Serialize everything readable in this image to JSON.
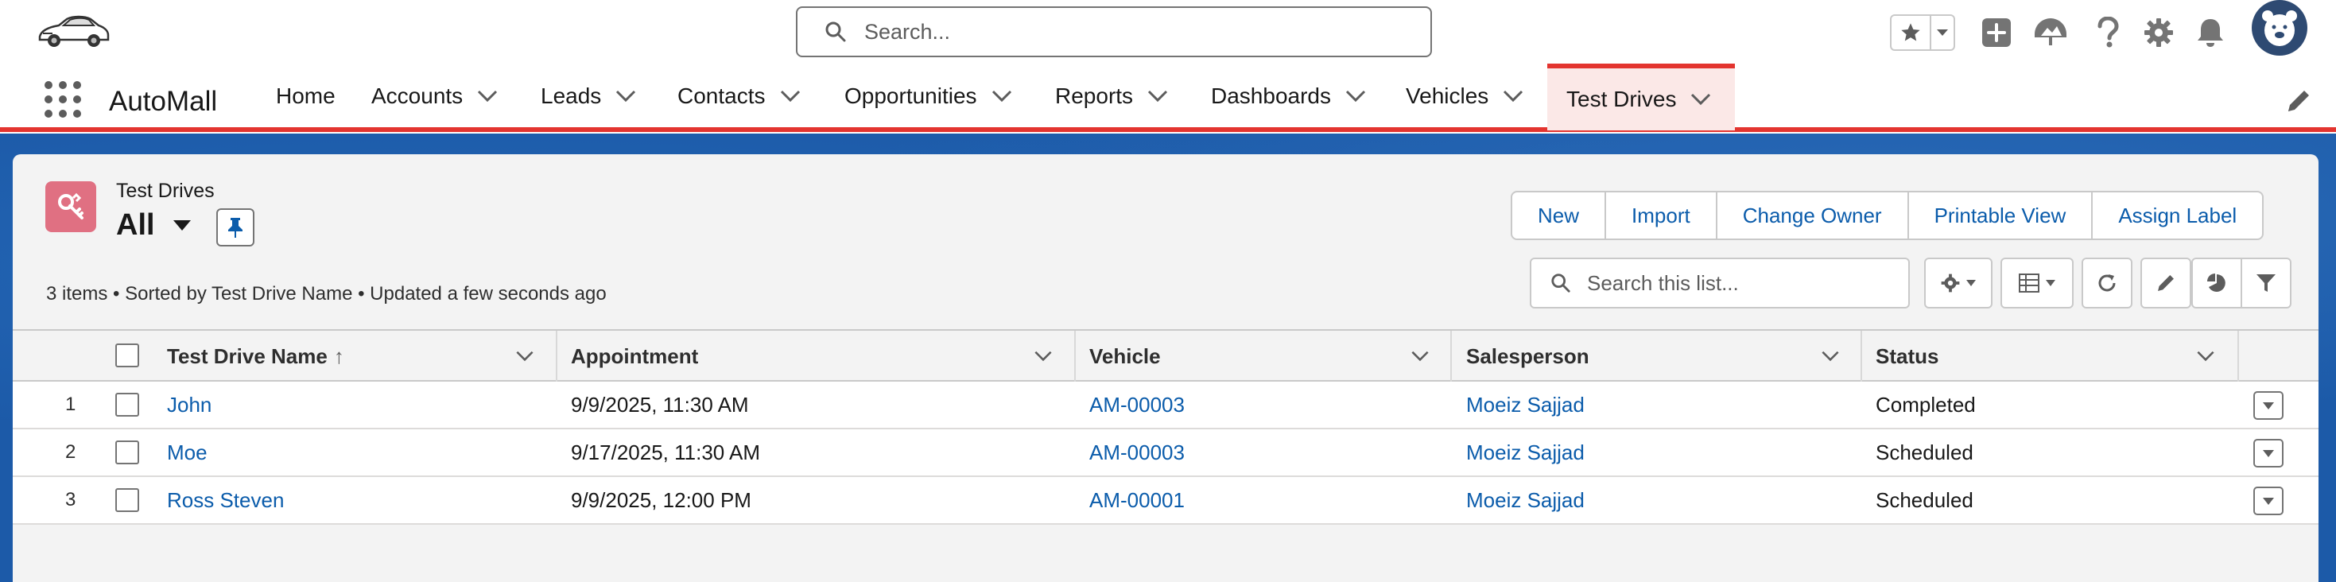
{
  "header": {
    "search_placeholder": "Search..."
  },
  "nav": {
    "app_name": "AutoMall",
    "items": [
      {
        "label": "Home"
      },
      {
        "label": "Accounts"
      },
      {
        "label": "Leads"
      },
      {
        "label": "Contacts"
      },
      {
        "label": "Opportunities"
      },
      {
        "label": "Reports"
      },
      {
        "label": "Dashboards"
      },
      {
        "label": "Vehicles"
      },
      {
        "label": "Test Drives",
        "active": true
      }
    ]
  },
  "list": {
    "object_label": "Test Drives",
    "view_name": "All",
    "meta": "3 items • Sorted by Test Drive Name • Updated a few seconds ago",
    "search_placeholder": "Search this list...",
    "buttons": [
      "New",
      "Import",
      "Change Owner",
      "Printable View",
      "Assign Label"
    ]
  },
  "table": {
    "columns": [
      "Test Drive Name",
      "Appointment",
      "Vehicle",
      "Salesperson",
      "Status"
    ],
    "sort_indicator": "↑",
    "rows": [
      {
        "num": "1",
        "name": "John",
        "appointment": "9/9/2025, 11:30 AM",
        "vehicle": "AM-00003",
        "salesperson": "Moeiz Sajjad",
        "status": "Completed"
      },
      {
        "num": "2",
        "name": "Moe",
        "appointment": "9/17/2025, 11:30 AM",
        "vehicle": "AM-00003",
        "salesperson": "Moeiz Sajjad",
        "status": "Scheduled"
      },
      {
        "num": "3",
        "name": "Ross Steven",
        "appointment": "9/9/2025, 12:00 PM",
        "vehicle": "AM-00001",
        "salesperson": "Moeiz Sajjad",
        "status": "Scheduled"
      }
    ]
  },
  "colors": {
    "accent": "#0b5cab",
    "active_tab": "#e3342f",
    "banner": "#1c5aa8",
    "object_icon": "#e07082"
  }
}
